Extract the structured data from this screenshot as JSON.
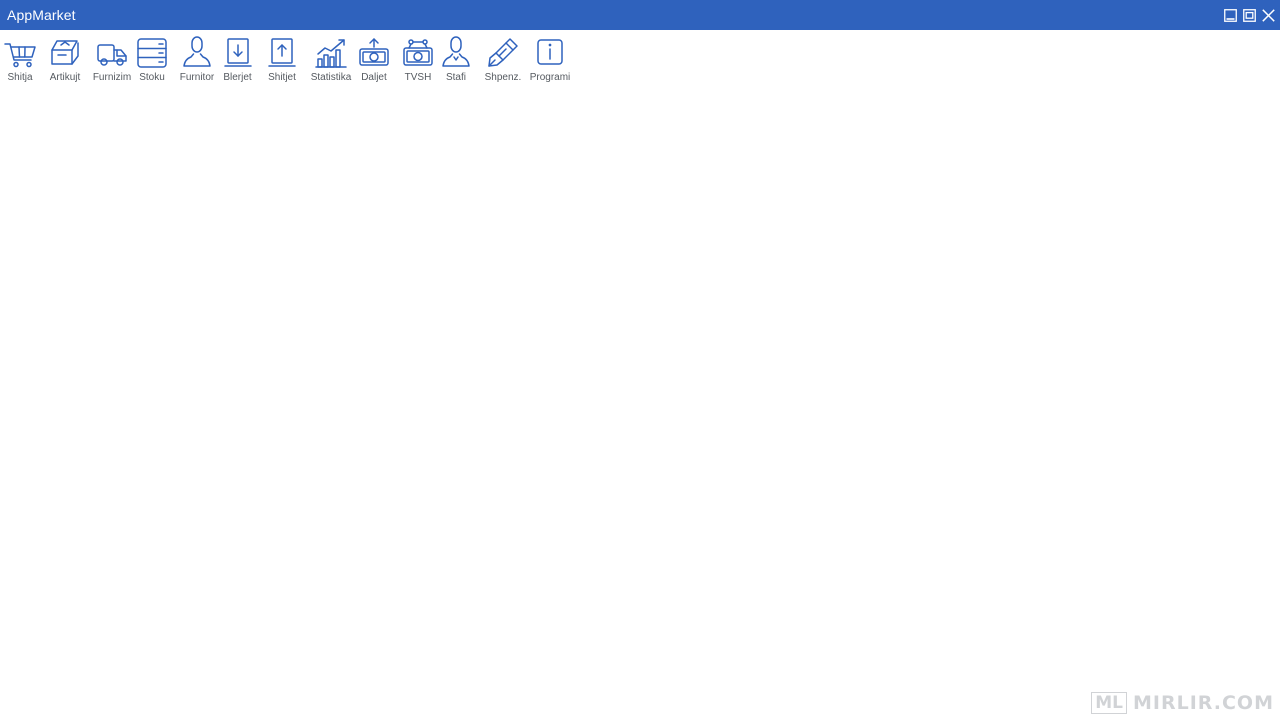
{
  "window": {
    "title": "AppMarket",
    "accent_color": "#2f62bd",
    "controls": [
      {
        "name": "minimize-icon"
      },
      {
        "name": "restore-icon"
      },
      {
        "name": "close-icon"
      }
    ]
  },
  "toolbar": {
    "icon_color": "#2f62bd",
    "items": [
      {
        "label": "Shitja",
        "icon": "cart-icon"
      },
      {
        "label": "Artikujt",
        "icon": "box-icon"
      },
      {
        "label": "Furnizim",
        "icon": "truck-icon"
      },
      {
        "label": "Stoku",
        "icon": "stack-icon"
      },
      {
        "label": "Furnitor",
        "icon": "person-icon"
      },
      {
        "label": "Blerjet",
        "icon": "download-icon"
      },
      {
        "label": "Shitjet",
        "icon": "upload-icon"
      },
      {
        "label": "Statistika",
        "icon": "bar-chart-icon"
      },
      {
        "label": "Daljet",
        "icon": "money-out-icon"
      },
      {
        "label": "TVSH",
        "icon": "money-tax-icon"
      },
      {
        "label": "Stafi",
        "icon": "staff-icon"
      },
      {
        "label": "Shpenz.",
        "icon": "pen-icon"
      },
      {
        "label": "Programi",
        "icon": "info-icon"
      }
    ]
  },
  "watermark": {
    "box": "ML",
    "text": "MIRLIR.COM"
  }
}
